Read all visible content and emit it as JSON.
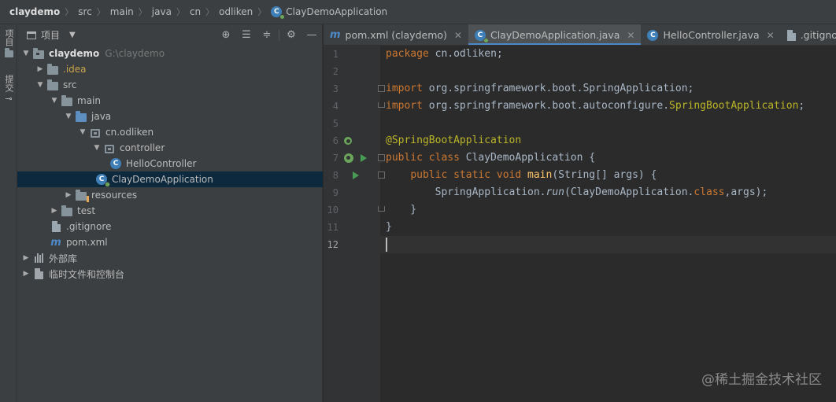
{
  "breadcrumb": [
    "claydemo",
    "src",
    "main",
    "java",
    "cn",
    "odliken",
    "ClayDemoApplication"
  ],
  "toolstrip": {
    "project_label": "项目",
    "commit_label": "提交"
  },
  "project_panel": {
    "title": "项目",
    "tree": [
      {
        "label": "claydemo",
        "path": "G:\\claydemo"
      },
      {
        "label": ".idea"
      },
      {
        "label": "src"
      },
      {
        "label": "main"
      },
      {
        "label": "java"
      },
      {
        "label": "cn.odliken"
      },
      {
        "label": "controller"
      },
      {
        "label": "HelloController"
      },
      {
        "label": "ClayDemoApplication"
      },
      {
        "label": "resources"
      },
      {
        "label": "test"
      },
      {
        "label": ".gitignore"
      },
      {
        "label": "pom.xml"
      },
      {
        "label": "外部库"
      },
      {
        "label": "临时文件和控制台"
      }
    ]
  },
  "editor": {
    "tabs": [
      {
        "label": "pom.xml (claydemo)",
        "icon": "maven-icon",
        "active": false
      },
      {
        "label": "ClayDemoApplication.java",
        "icon": "spring-class-icon",
        "active": true
      },
      {
        "label": "HelloController.java",
        "icon": "class-icon",
        "active": false
      },
      {
        "label": ".gitignore",
        "icon": "file-icon",
        "active": false
      }
    ],
    "line_numbers": [
      "1",
      "2",
      "3",
      "4",
      "5",
      "6",
      "7",
      "8",
      "9",
      "10",
      "11",
      "12"
    ],
    "code": {
      "l1_kw": "package ",
      "l1_rest": "cn.odliken;",
      "l3_kw": "import ",
      "l3_rest": "org.springframework.boot.SpringApplication;",
      "l4_kw": "import ",
      "l4_rest": "org.springframework.boot.autoconfigure.",
      "l4_ann": "SpringBootApplication",
      "l4_end": ";",
      "l6_ann": "@SpringBootApplication",
      "l7_kw": "public class ",
      "l7_rest": "ClayDemoApplication {",
      "l8_indent": "    ",
      "l8_kw": "public static void ",
      "l8_fn": "main",
      "l8_rest": "(String[] args) {",
      "l9_indent": "        ",
      "l9_a": "SpringApplication.",
      "l9_run": "run",
      "l9_b": "(ClayDemoApplication.",
      "l9_kw": "class",
      "l9_c": ",args);",
      "l10": "    }",
      "l11": "}"
    }
  },
  "watermark": "@稀土掘金技术社区"
}
